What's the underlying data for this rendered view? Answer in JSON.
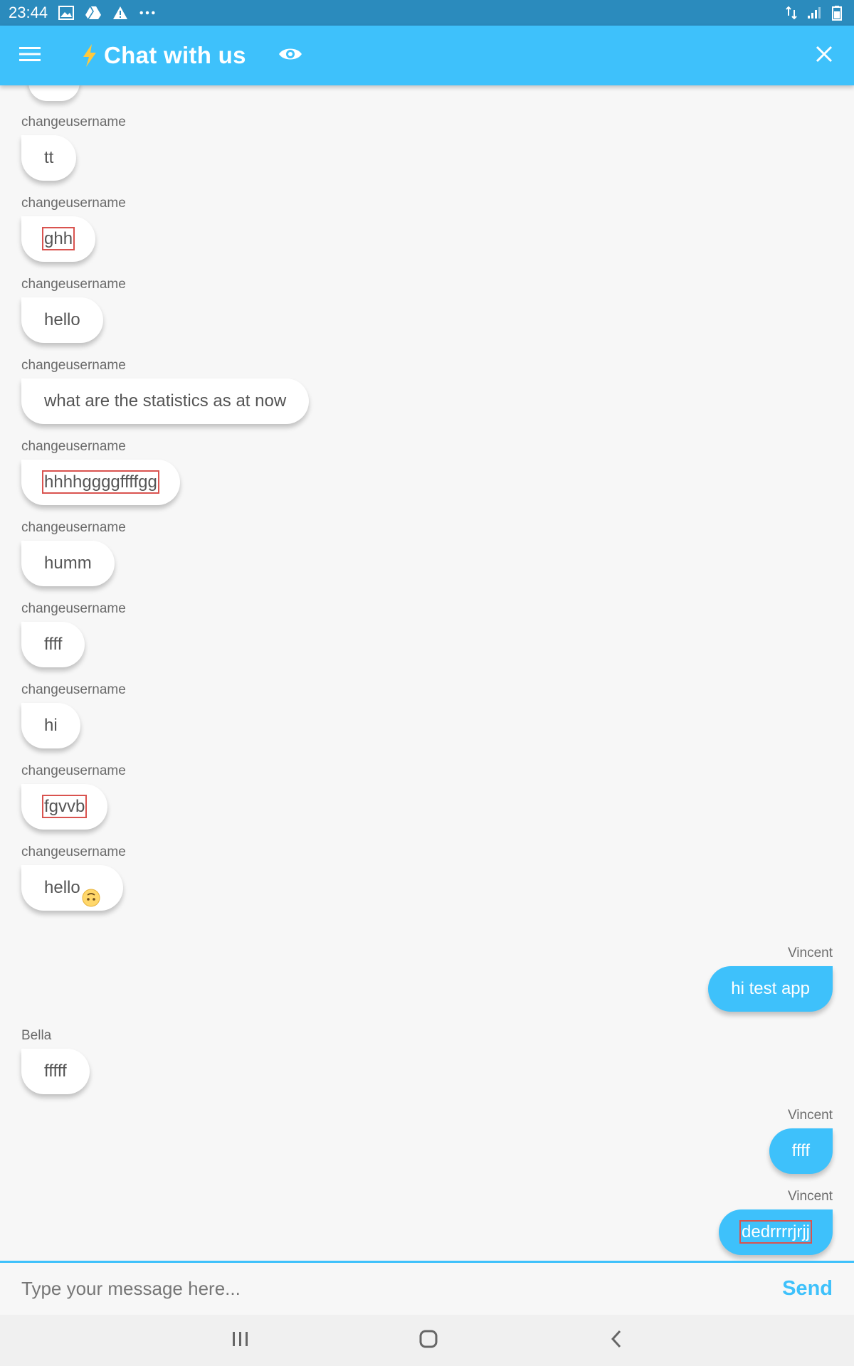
{
  "status_bar": {
    "time": "23:44",
    "icons_left": [
      "image-icon",
      "drive-icon",
      "warning-icon",
      "more-dots-icon"
    ],
    "icons_right": [
      "data-arrows-icon",
      "signal-icon",
      "battery-icon"
    ]
  },
  "app_bar": {
    "title": "Chat with us",
    "colors": {
      "background": "#3ec1fb",
      "bolt": "#ffc93c"
    }
  },
  "messages": [
    {
      "sender": "changeusername",
      "text": "tt",
      "side": "left",
      "highlighted": false
    },
    {
      "sender": "changeusername",
      "text": "ghh",
      "side": "left",
      "highlighted": true
    },
    {
      "sender": "changeusername",
      "text": "hello",
      "side": "left",
      "highlighted": false
    },
    {
      "sender": "changeusername",
      "text": "what are the statistics as at now",
      "side": "left",
      "highlighted": false
    },
    {
      "sender": "changeusername",
      "text": "hhhhggggffffgg",
      "side": "left",
      "highlighted": true
    },
    {
      "sender": "changeusername",
      "text": "humm",
      "side": "left",
      "highlighted": false
    },
    {
      "sender": "changeusername",
      "text": "ffff",
      "side": "left",
      "highlighted": false
    },
    {
      "sender": "changeusername",
      "text": "hi",
      "side": "left",
      "highlighted": false
    },
    {
      "sender": "changeusername",
      "text": "fgvvb",
      "side": "left",
      "highlighted": true
    },
    {
      "sender": "changeusername",
      "text": "hello",
      "side": "left",
      "highlighted": false,
      "emoji": "upside-down-face-icon"
    },
    {
      "sender": "Vincent",
      "text": "hi test app",
      "side": "right",
      "highlighted": false
    },
    {
      "sender": "Bella",
      "text": "fffff",
      "side": "left",
      "highlighted": false
    },
    {
      "sender": "Vincent",
      "text": "ffff",
      "side": "right",
      "highlighted": false
    },
    {
      "sender": "Vincent",
      "text": "dedrrrrjrjj",
      "side": "right",
      "highlighted": true
    }
  ],
  "composer": {
    "placeholder": "Type your message here...",
    "value": "",
    "send_label": "Send"
  },
  "nav_bar": {
    "buttons": [
      "recents-icon",
      "home-icon",
      "back-icon"
    ]
  },
  "colors": {
    "accent": "#3ec1fb",
    "status_bar": "#2b8bbd",
    "highlight_box": "#d9534f",
    "incoming_bubble": "#ffffff",
    "outgoing_bubble": "#3ec1fb"
  }
}
